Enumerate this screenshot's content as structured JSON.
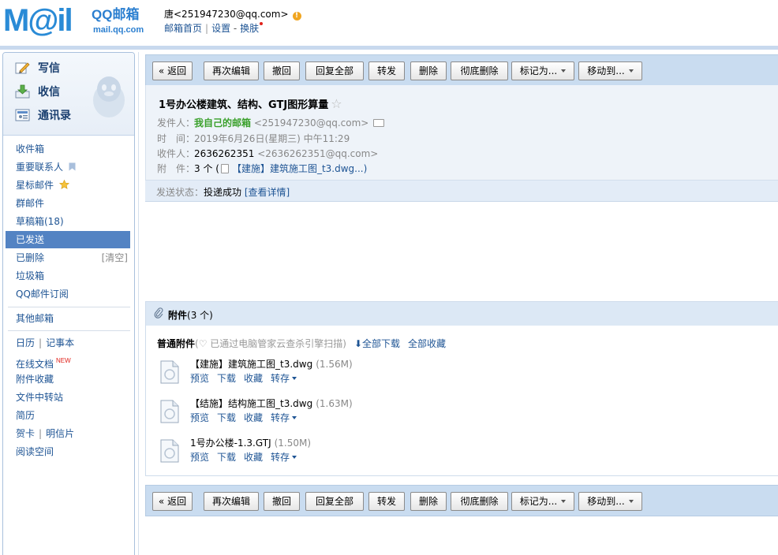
{
  "header": {
    "logo_word": "M@il",
    "brand": "QQ邮箱",
    "domain": "mail.qq.com",
    "user": "唐<251947230@qq.com>",
    "warn_glyph": "!",
    "links": {
      "home": "邮箱首页",
      "settings": "设置",
      "dash": "-",
      "skin": "换肤"
    }
  },
  "sidebar": {
    "quick": {
      "write": "写信",
      "receive": "收信",
      "contacts": "通讯录"
    },
    "folders": {
      "inbox": "收件箱",
      "important": "重要联系人",
      "starred": "星标邮件",
      "group": "群邮件",
      "drafts": "草稿箱(18)",
      "sent": "已发送",
      "deleted": "已删除",
      "deleted_clear": "[清空]",
      "spam": "垃圾箱",
      "subscriptions": "QQ邮件订阅",
      "other": "其他邮箱",
      "calendar": "日历",
      "notes": "记事本",
      "docs": "在线文档",
      "docs_badge": "NEW",
      "att_fav": "附件收藏",
      "file_transfer": "文件中转站",
      "resume": "简历",
      "card": "贺卡",
      "postcard": "明信片",
      "reading": "阅读空间"
    }
  },
  "toolbar": {
    "back": "« 返回",
    "reedit": "再次编辑",
    "recall": "撤回",
    "reply_all": "回复全部",
    "forward": "转发",
    "delete": "删除",
    "delete_perm": "彻底删除",
    "mark_as": "标记为...",
    "move_to": "移动到..."
  },
  "mail": {
    "subject": "1号办公楼建筑、结构、GTJ图形算量",
    "star_glyph": "☆",
    "from_label": "发件人：",
    "from_name": "我自己的邮箱",
    "from_addr": "<251947230@qq.com>",
    "time_label": "时　间：",
    "time": "2019年6月26日(星期三) 中午11:29",
    "to_label": "收件人：",
    "to_name": "2636262351",
    "to_addr": "<2636262351@qq.com>",
    "att_label": "附　件：",
    "att_count": "3 个",
    "att_open": "(",
    "att_preview": "【建施】建筑施工图_t3.dwg...)",
    "status_label": "发送状态：",
    "status": "投递成功",
    "status_link": "[查看详情]"
  },
  "attachments": {
    "title": "附件",
    "count": "(3 个)",
    "type_label": "普通附件",
    "scan_note": "(♡ 已通过电脑管家云查杀引擎扫描)",
    "download_all": "⬇全部下载",
    "save_all": "全部收藏",
    "ops": {
      "preview": "预览",
      "download": "下载",
      "save": "收藏",
      "transfer": "转存"
    },
    "files": [
      {
        "name": "【建施】建筑施工图_t3.dwg",
        "size": "(1.56M)"
      },
      {
        "name": "【结施】结构施工图_t3.dwg",
        "size": "(1.63M)"
      },
      {
        "name": "1号办公楼-1.3.GTJ",
        "size": "(1.50M)"
      }
    ]
  }
}
